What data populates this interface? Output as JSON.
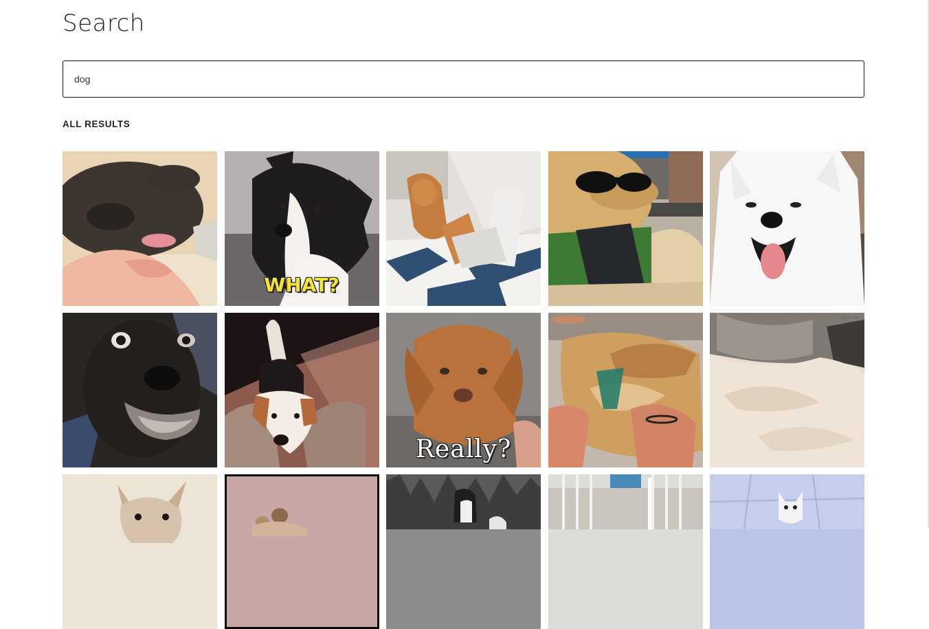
{
  "page": {
    "title": "Search"
  },
  "search": {
    "query": "dog",
    "placeholder": ""
  },
  "results": {
    "heading": "ALL RESULTS",
    "items": [
      {
        "name": "gif-result-sleepy-black-dog",
        "caption": ""
      },
      {
        "name": "gif-result-what-dog",
        "caption": "WHAT?"
      },
      {
        "name": "gif-result-shiba-laptop",
        "caption": ""
      },
      {
        "name": "gif-result-sunglasses-dog-car",
        "caption": ""
      },
      {
        "name": "gif-result-white-samoyed",
        "caption": ""
      },
      {
        "name": "gif-result-startled-black-dog",
        "caption": ""
      },
      {
        "name": "gif-result-beagle-couch",
        "caption": ""
      },
      {
        "name": "gif-result-really-puppy",
        "caption": "Really?"
      },
      {
        "name": "gif-result-dog-belly-rub",
        "caption": ""
      },
      {
        "name": "gif-result-fluffy-rug",
        "caption": "gifak.net"
      },
      {
        "name": "gif-result-chihuahua",
        "caption": ""
      },
      {
        "name": "gif-result-small-dogs-framed",
        "caption": ""
      },
      {
        "name": "gif-result-dog-bw-forest",
        "caption": ""
      },
      {
        "name": "gif-result-dog-gate",
        "caption": ""
      },
      {
        "name": "gif-result-white-dog-tiles",
        "caption": ""
      }
    ]
  },
  "colors": {
    "text": "#222222",
    "search_border": "#111111",
    "caption_yellow": "#f3e23a"
  }
}
